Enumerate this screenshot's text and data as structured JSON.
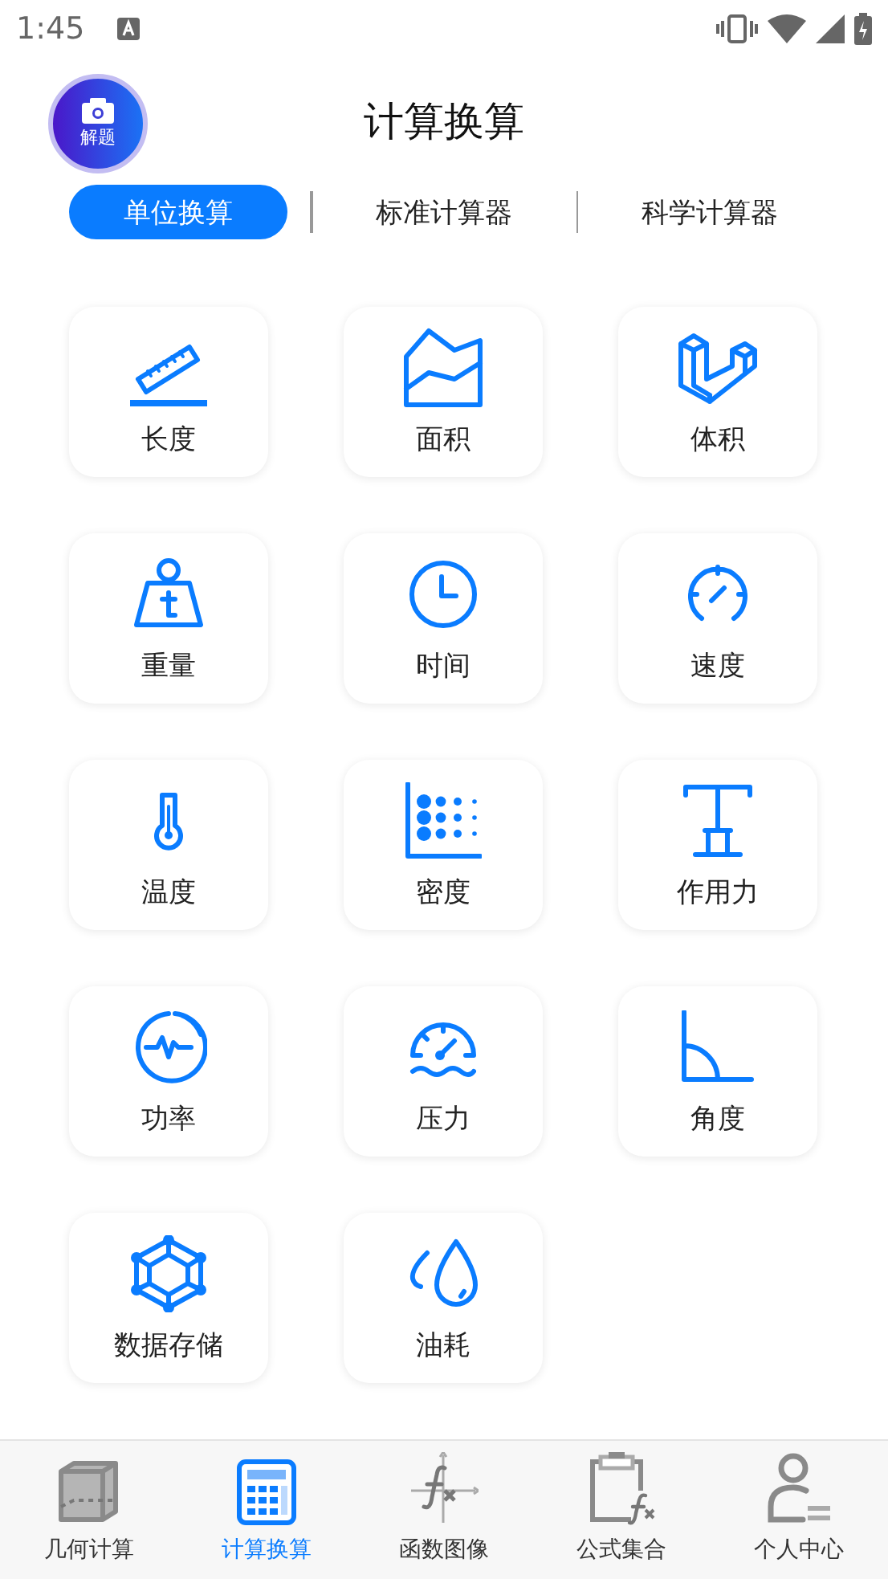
{
  "status_bar": {
    "time": "1:45"
  },
  "header": {
    "solve_button": {
      "label": "解题"
    },
    "title": "计算换算"
  },
  "tabs": [
    {
      "label": "单位换算",
      "selected": true
    },
    {
      "label": "标准计算器",
      "selected": false
    },
    {
      "label": "科学计算器",
      "selected": false
    }
  ],
  "converters": [
    {
      "label": "长度",
      "kind": "ruler"
    },
    {
      "label": "面积",
      "kind": "area"
    },
    {
      "label": "体积",
      "kind": "blocks"
    },
    {
      "label": "重量",
      "kind": "weight"
    },
    {
      "label": "时间",
      "kind": "clock"
    },
    {
      "label": "速度",
      "kind": "gauge"
    },
    {
      "label": "温度",
      "kind": "thermometer"
    },
    {
      "label": "密度",
      "kind": "dots"
    },
    {
      "label": "作用力",
      "kind": "press"
    },
    {
      "label": "功率",
      "kind": "pulse"
    },
    {
      "label": "压力",
      "kind": "pressure"
    },
    {
      "label": "角度",
      "kind": "angle"
    },
    {
      "label": "数据存储",
      "kind": "network"
    },
    {
      "label": "油耗",
      "kind": "drops"
    }
  ],
  "bottom_nav": [
    {
      "label": "几何计算",
      "kind": "cube",
      "selected": false
    },
    {
      "label": "计算换算",
      "kind": "calculator",
      "selected": true
    },
    {
      "label": "函数图像",
      "kind": "graph",
      "selected": false
    },
    {
      "label": "公式集合",
      "kind": "clipboard",
      "selected": false
    },
    {
      "label": "个人中心",
      "kind": "person",
      "selected": false
    }
  ]
}
